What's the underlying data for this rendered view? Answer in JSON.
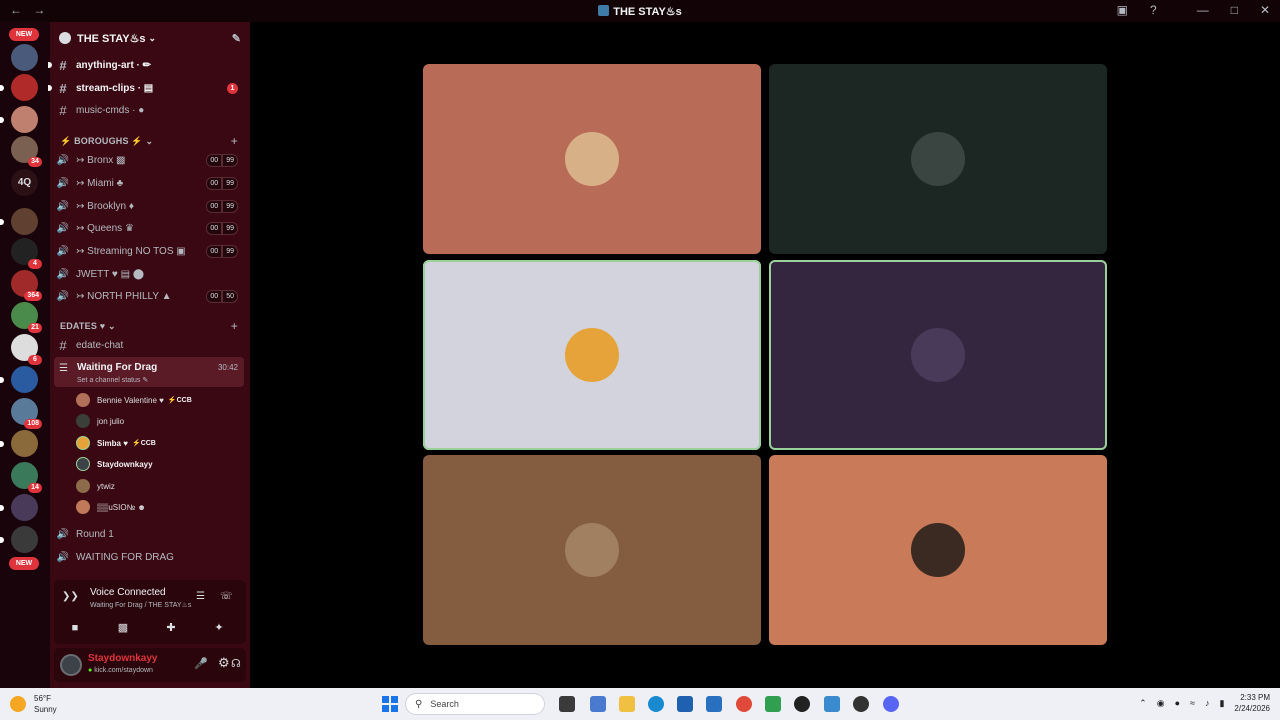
{
  "window": {
    "title": "THE STAY♨s",
    "nav_back": "←",
    "nav_forward": "→",
    "controls": [
      "—",
      "□",
      "✕"
    ]
  },
  "servers": {
    "new_top": "NEW",
    "new_bottom": "NEW",
    "text_server": "4Q",
    "badges": [
      "34",
      "4",
      "364",
      "21",
      "6",
      "108",
      "14"
    ]
  },
  "guild": {
    "name": "THE STAY♨s"
  },
  "channels": {
    "text_top": [
      {
        "name": "anything-art · ✏",
        "bold": true,
        "unread": true
      },
      {
        "name": "stream-clips · ▤",
        "bold": true,
        "unread": true,
        "badge": "1"
      },
      {
        "name": "music-cmds · ●",
        "bold": false
      }
    ],
    "boroughs_category": "⚡ BOROUGHS ⚡",
    "boroughs": [
      {
        "name": "↣ Bronx ▩",
        "count_a": "00",
        "count_b": "99"
      },
      {
        "name": "↣ Miami ♣",
        "count_a": "00",
        "count_b": "99"
      },
      {
        "name": "↣ Brooklyn ♦",
        "count_a": "00",
        "count_b": "99"
      },
      {
        "name": "↣ Queens ♛",
        "count_a": "00",
        "count_b": "99"
      },
      {
        "name": "↣ Streaming NO TOS ▣",
        "count_a": "00",
        "count_b": "99"
      },
      {
        "name": "JWETT ♥ ▤ ⬤",
        "count_a": "",
        "count_b": ""
      },
      {
        "name": "↣ NORTH PHILLY ▲",
        "count_a": "00",
        "count_b": "50"
      }
    ],
    "edates_category": "EDATES ♥",
    "edate_chat": "edate-chat",
    "active_voice": {
      "name": "Waiting For Drag",
      "status": "Set a channel status ✎",
      "time": "30:42"
    },
    "voice_users": [
      {
        "name": "Bennie Valentine ♥",
        "tag": "⚡CCB",
        "bold": false,
        "color": "#b0705a"
      },
      {
        "name": "jon julio",
        "tag": "",
        "bold": false,
        "color": "#3a3f3a"
      },
      {
        "name": "Simba ♥",
        "tag": "⚡CCB",
        "bold": true,
        "color": "#e6a33a"
      },
      {
        "name": "Staydownkayy",
        "tag": "",
        "bold": true,
        "color": "#3d4248"
      },
      {
        "name": "ytwiz",
        "tag": "",
        "bold": false,
        "color": "#8b6b4a"
      },
      {
        "name": "▒▒uSIO№ ☻",
        "tag": "",
        "bold": false,
        "color": "#c07a5a"
      }
    ],
    "after": [
      {
        "name": "Round 1"
      },
      {
        "name": "WAITING FOR DRAG"
      }
    ]
  },
  "voice_panel": {
    "title": "Voice Connected",
    "subtitle": "Waiting For Drag / THE STAY♨s"
  },
  "user_panel": {
    "username": "Staydownkayy",
    "status": "kick.com/staydown"
  },
  "tiles": [
    {
      "bg": "#b86c58",
      "face": "#d8b088",
      "speaking": false
    },
    {
      "bg": "#1c2623",
      "face": "#3a4440",
      "speaking": false
    },
    {
      "bg": "#d3d3de",
      "face": "#e6a33a",
      "speaking": true
    },
    {
      "bg": "#35263f",
      "face": "#4a3a5a",
      "speaking": true
    },
    {
      "bg": "#845c40",
      "face": "#a08060",
      "speaking": false
    },
    {
      "bg": "#c97b59",
      "face": "#3a2a22",
      "speaking": false
    }
  ],
  "taskbar": {
    "temp": "56°F",
    "weather": "Sunny",
    "search_placeholder": "Search",
    "time": "2:33 PM",
    "date": "2/24/2026"
  }
}
